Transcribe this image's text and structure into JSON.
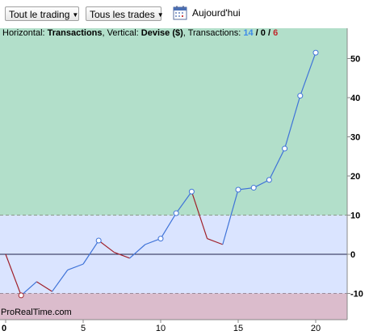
{
  "toolbar": {
    "trading_dropdown": "Tout le trading",
    "trades_dropdown": "Tous les trades",
    "today_label": "Aujourd'hui"
  },
  "info": {
    "h_prefix": "Horizontal: ",
    "h_value": "Transactions",
    "v_prefix": ", Vertical: ",
    "v_value": "Devise ($)",
    "t_prefix": ", Transactions: ",
    "t_total": "14",
    "sep1": " / ",
    "t_zero": "0",
    "sep2": " / ",
    "t_neg": "6"
  },
  "watermark": "ProRealTime.com",
  "colors": {
    "gain_zone": "#b2dfca",
    "neutral_zone": "#dae4ff",
    "loss_zone": "#dbbccc",
    "up_line": "#3f73d8",
    "down_line": "#a0202a",
    "total_count": "#3d8be8",
    "neg_count": "#c0282c"
  },
  "chart_data": {
    "type": "line",
    "xlabel": "Transactions",
    "ylabel": "Devise ($)",
    "xlim": [
      0,
      22
    ],
    "ylim": [
      -15,
      57
    ],
    "x_ticks": [
      0,
      5,
      10,
      15,
      20
    ],
    "y_ticks": [
      -10,
      0,
      10,
      20,
      30,
      40,
      50
    ],
    "zones": {
      "upper_threshold": 10,
      "lower_threshold": -10
    },
    "series": [
      {
        "x": [
          0,
          1,
          2,
          3,
          4,
          5,
          6,
          7,
          8,
          9,
          10,
          11,
          12,
          13,
          14,
          15,
          16,
          17,
          18,
          19,
          20
        ],
        "values": [
          0,
          -10.5,
          -7,
          -9.5,
          -4,
          -2.5,
          3.5,
          0.5,
          -1,
          2.5,
          4,
          10.5,
          16,
          4,
          2.5,
          16.5,
          17,
          19,
          27,
          40.5,
          51.5
        ]
      }
    ],
    "markers": [
      1,
      6,
      10,
      11,
      12,
      15,
      16,
      17,
      18,
      19,
      20
    ],
    "grid": false
  }
}
